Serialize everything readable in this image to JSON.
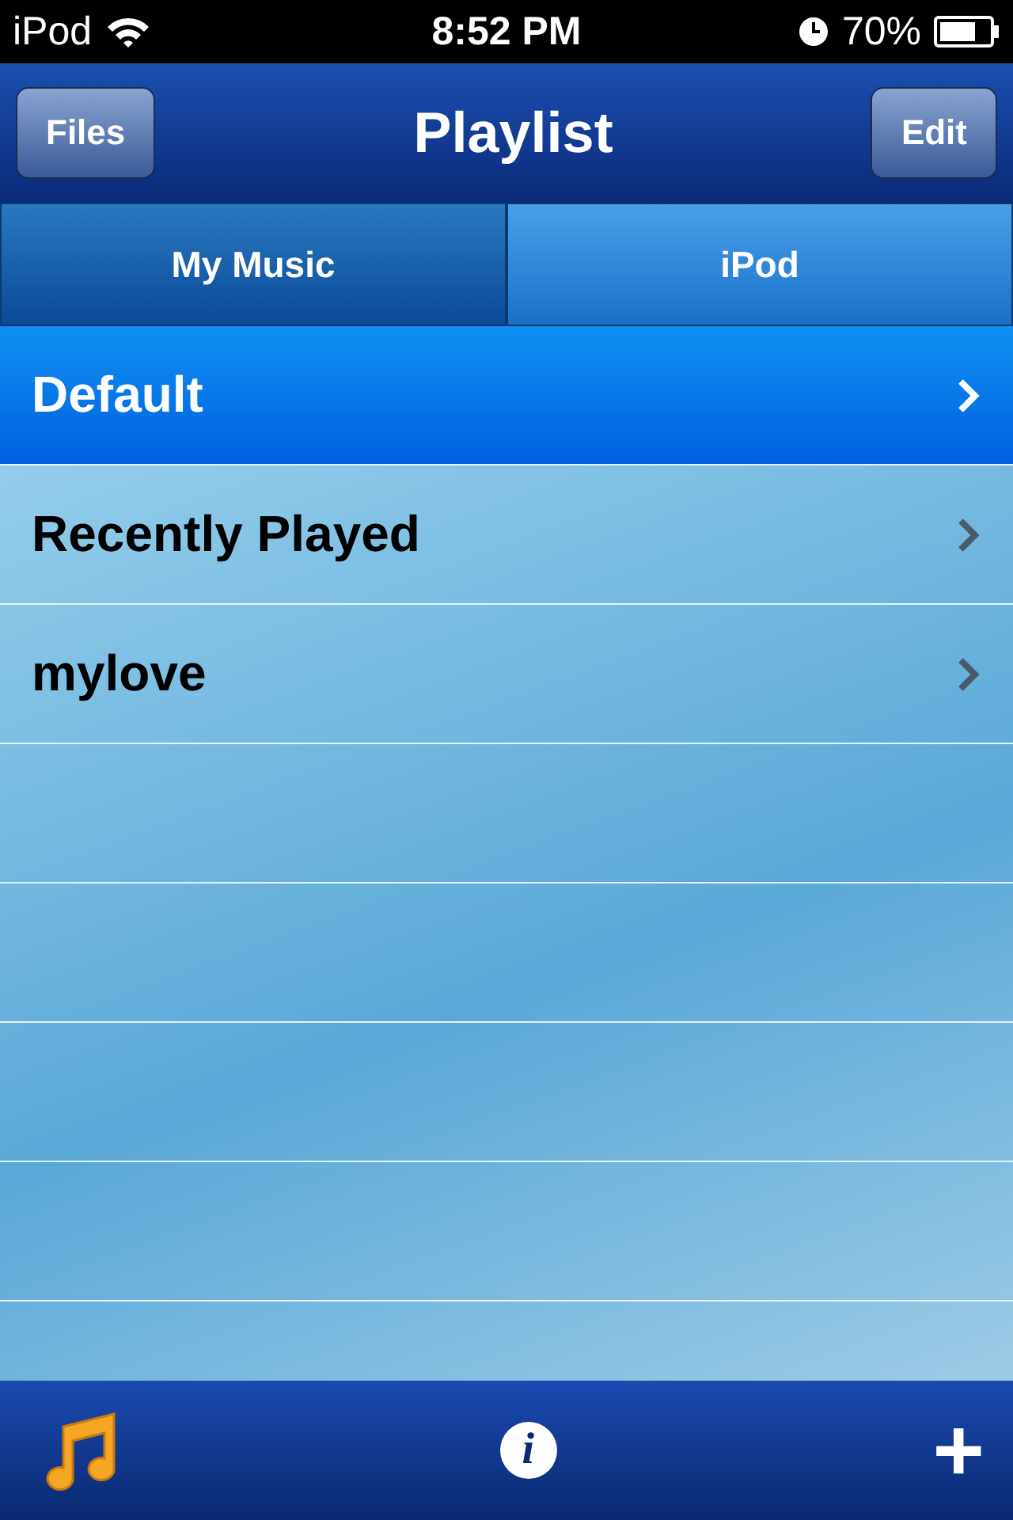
{
  "status_bar": {
    "carrier": "iPod",
    "time": "8:52 PM",
    "battery": "70%"
  },
  "nav_bar": {
    "left_button": "Files",
    "title": "Playlist",
    "right_button": "Edit"
  },
  "segments": [
    {
      "label": "My Music",
      "selected": true
    },
    {
      "label": "iPod",
      "selected": false
    }
  ],
  "playlists": [
    {
      "name": "Default",
      "selected": true
    },
    {
      "name": "Recently Played",
      "selected": false
    },
    {
      "name": "mylove",
      "selected": false
    }
  ],
  "toolbar": {
    "info_label": "i",
    "add_label": "+"
  }
}
